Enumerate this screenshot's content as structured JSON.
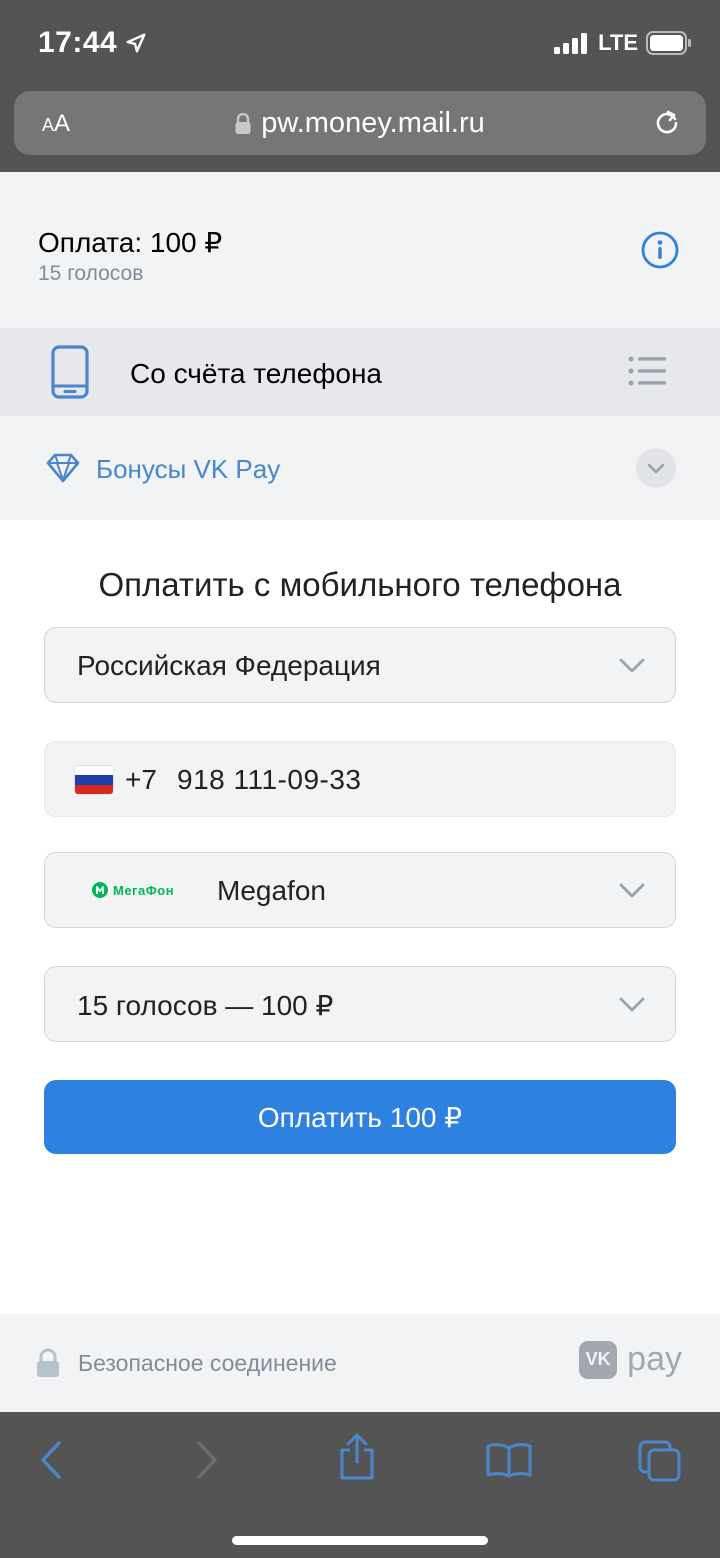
{
  "statusbar": {
    "time": "17:44",
    "network": "LTE"
  },
  "browser": {
    "text_size_label_small": "A",
    "text_size_label_large": "A",
    "url": "pw.money.mail.ru"
  },
  "payment": {
    "title": "Оплата: 100 ₽",
    "subtitle": "15 голосов"
  },
  "method": {
    "label": "Со счёта телефона"
  },
  "bonus": {
    "label": "Бонусы VK Pay"
  },
  "form": {
    "title": "Оплатить с мобильного телефона",
    "country": "Российская Федерация",
    "phone_code": "+7",
    "phone_number": "918 111-09-33",
    "operator_logo_text": "МегаФон",
    "operator": "Megafon",
    "amount": "15 голосов — 100 ₽",
    "pay_button": "Оплатить 100 ₽"
  },
  "footer": {
    "secure": "Безопасное соединение",
    "brand_vk": "VK",
    "brand_pay": "pay"
  },
  "colors": {
    "accent": "#2d81e0",
    "link": "#4986cc",
    "chrome": "#545454",
    "megafon": "#00b956"
  },
  "icons": [
    "location-arrow-icon",
    "signal-icon",
    "battery-icon",
    "lock-icon",
    "reload-icon",
    "info-icon",
    "phone-icon",
    "list-icon",
    "diamond-icon",
    "chevron-down-icon",
    "back-icon",
    "forward-icon",
    "share-icon",
    "bookmarks-icon",
    "tabs-icon"
  ]
}
